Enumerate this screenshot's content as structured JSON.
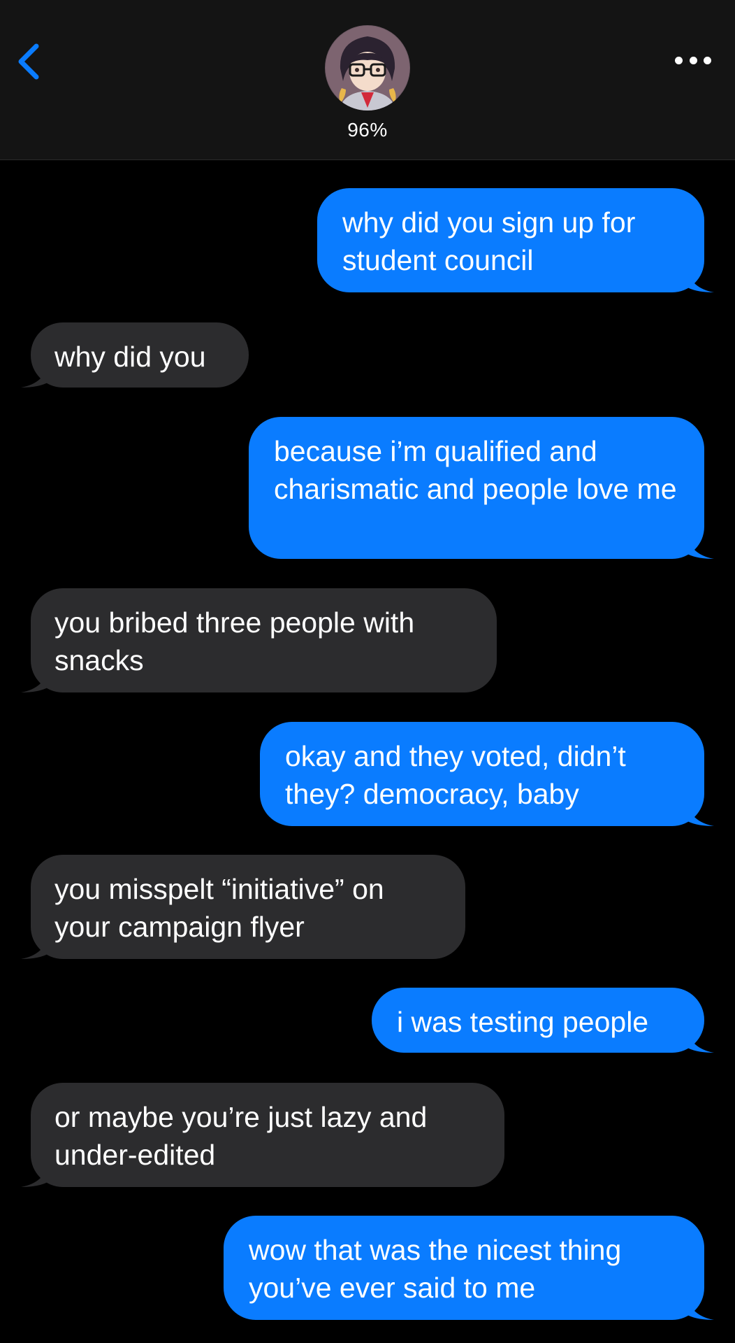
{
  "header": {
    "contact_name": "96%",
    "back_icon": "chevron-left-icon",
    "more_icon": "ellipsis-icon",
    "accent_color": "#0a7cff"
  },
  "messages": [
    {
      "direction": "sent",
      "text": "why did you sign up for student council"
    },
    {
      "direction": "received",
      "text": "why did you"
    },
    {
      "direction": "sent",
      "text": "because i’m qualified and charismatic and people love me"
    },
    {
      "direction": "received",
      "text": "you bribed three people with snacks"
    },
    {
      "direction": "sent",
      "text": "okay and they voted, didn’t they? democracy, baby"
    },
    {
      "direction": "received",
      "text": "you misspelt “initiative” on your campaign flyer"
    },
    {
      "direction": "sent",
      "text": "i was testing people"
    },
    {
      "direction": "received",
      "text": "or maybe you’re just lazy and under-edited"
    },
    {
      "direction": "sent",
      "text": "wow that was the nicest thing you’ve ever said to me"
    }
  ],
  "colors": {
    "sent_bubble": "#0a7cff",
    "received_bubble": "#2c2c2e",
    "background": "#000000",
    "header_background": "#141414"
  }
}
